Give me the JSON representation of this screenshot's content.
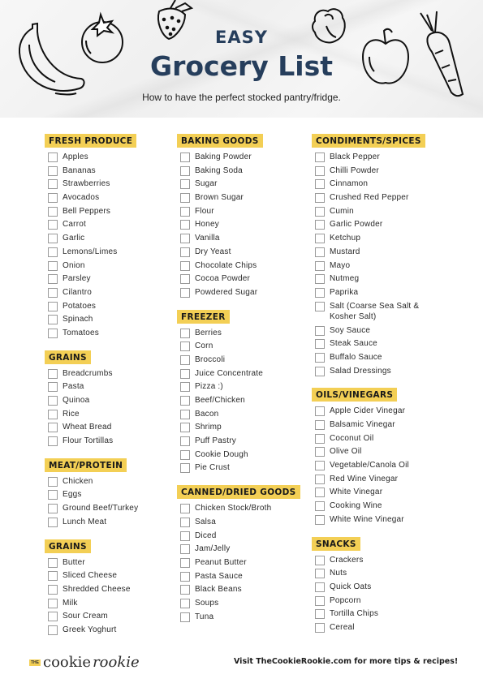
{
  "header": {
    "eyebrow": "EASY",
    "title": "Grocery List",
    "subtitle": "How to have the perfect stocked pantry/fridge."
  },
  "colors": {
    "accent": "#f3cf55",
    "title": "#263e5c"
  },
  "columns": [
    {
      "sections": [
        {
          "heading": "FRESH PRODUCE",
          "items": [
            "Apples",
            "Bananas",
            "Strawberries",
            "Avocados",
            "Bell Peppers",
            "Carrot",
            "Garlic",
            "Lemons/Limes",
            "Onion",
            "Parsley",
            "Cilantro",
            "Potatoes",
            "Spinach",
            "Tomatoes"
          ]
        },
        {
          "heading": "GRAINS",
          "items": [
            "Breadcrumbs",
            "Pasta",
            "Quinoa",
            "Rice",
            "Wheat Bread",
            "Flour Tortillas"
          ]
        },
        {
          "heading": "MEAT/PROTEIN",
          "items": [
            "Chicken",
            "Eggs",
            "Ground Beef/Turkey",
            "Lunch Meat"
          ]
        },
        {
          "heading": "GRAINS",
          "items": [
            "Butter",
            "Sliced Cheese",
            "Shredded Cheese",
            "Milk",
            "Sour Cream",
            "Greek Yoghurt"
          ]
        }
      ]
    },
    {
      "sections": [
        {
          "heading": "BAKING GOODS",
          "items": [
            "Baking Powder",
            "Baking Soda",
            "Sugar",
            "Brown Sugar",
            "Flour",
            "Honey",
            "Vanilla",
            "Dry Yeast",
            "Chocolate Chips",
            "Cocoa Powder",
            "Powdered Sugar"
          ]
        },
        {
          "heading": "FREEZER",
          "items": [
            "Berries",
            "Corn",
            "Broccoli",
            "Juice Concentrate",
            "Pizza :)",
            "Beef/Chicken",
            "Bacon",
            "Shrimp",
            "Puff Pastry",
            "Cookie Dough",
            "Pie Crust"
          ]
        },
        {
          "heading": "CANNED/DRIED GOODS",
          "items": [
            "Chicken Stock/Broth",
            "Salsa",
            "Diced",
            "Jam/Jelly",
            "Peanut Butter",
            "Pasta Sauce",
            "Black Beans",
            "Soups",
            "Tuna"
          ]
        }
      ]
    },
    {
      "sections": [
        {
          "heading": "CONDIMENTS/SPICES",
          "items": [
            "Black Pepper",
            "Chilli Powder",
            "Cinnamon",
            "Crushed Red Pepper",
            "Cumin",
            "Garlic Powder",
            "Ketchup",
            "Mustard",
            "Mayo",
            "Nutmeg",
            "Paprika",
            "Salt (Coarse Sea Salt & Kosher Salt)",
            "Soy Sauce",
            "Steak Sauce",
            "Buffalo Sauce",
            "Salad Dressings"
          ]
        },
        {
          "heading": "OILS/VINEGARS",
          "items": [
            "Apple Cider Vinegar",
            "Balsamic Vinegar",
            "Coconut Oil",
            "Olive Oil",
            "Vegetable/Canola Oil",
            "Red Wine Vinegar",
            "White Vinegar",
            "Cooking Wine",
            "White Wine Vinegar"
          ]
        },
        {
          "heading": "SNACKS",
          "items": [
            "Crackers",
            "Nuts",
            "Quick Oats",
            "Popcorn",
            "Tortilla Chips",
            "Cereal"
          ]
        }
      ]
    }
  ],
  "footer": {
    "logo_the": "THE",
    "logo_cookie": "cookie",
    "logo_rookie": "rookie",
    "tagline": "Visit TheCookieRookie.com for more tips & recipes!"
  }
}
